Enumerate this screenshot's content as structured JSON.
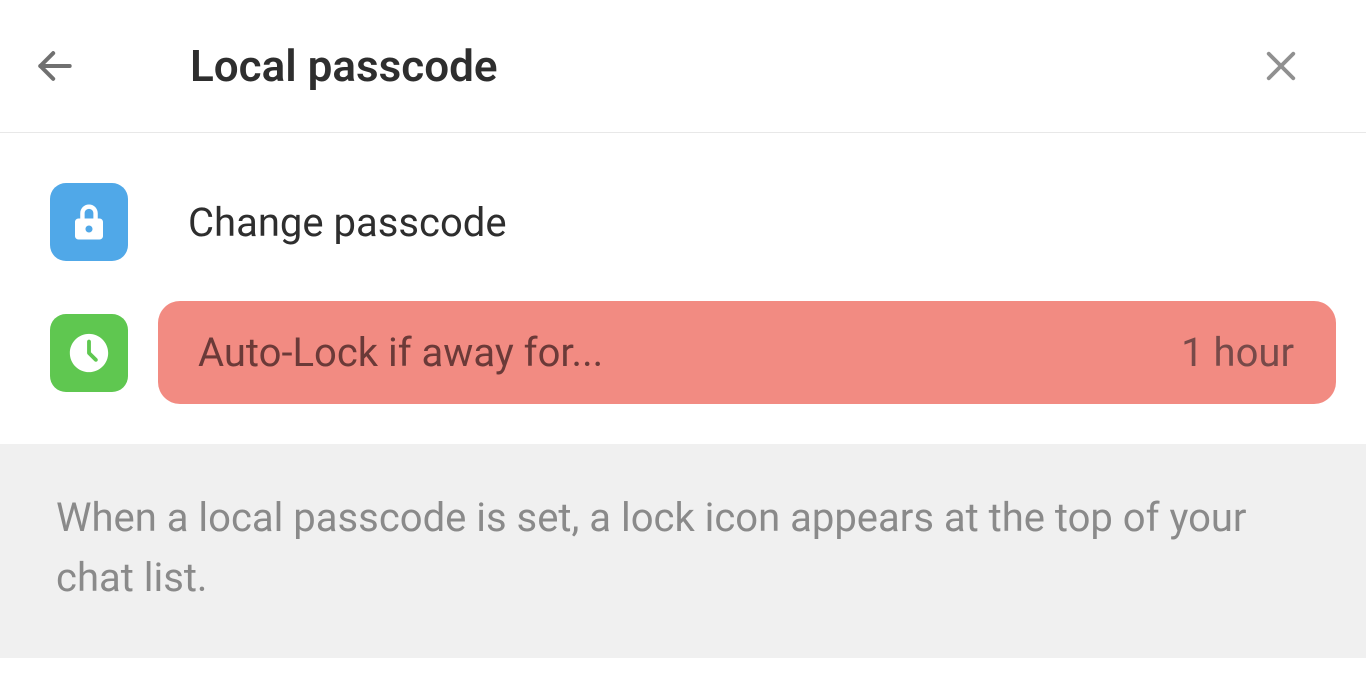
{
  "header": {
    "title": "Local passcode"
  },
  "items": {
    "change_passcode": {
      "label": "Change passcode"
    },
    "auto_lock": {
      "label": "Auto-Lock if away for...",
      "value": "1 hour"
    }
  },
  "footer": {
    "note": "When a local passcode is set, a lock icon appears at the top of your chat list."
  }
}
